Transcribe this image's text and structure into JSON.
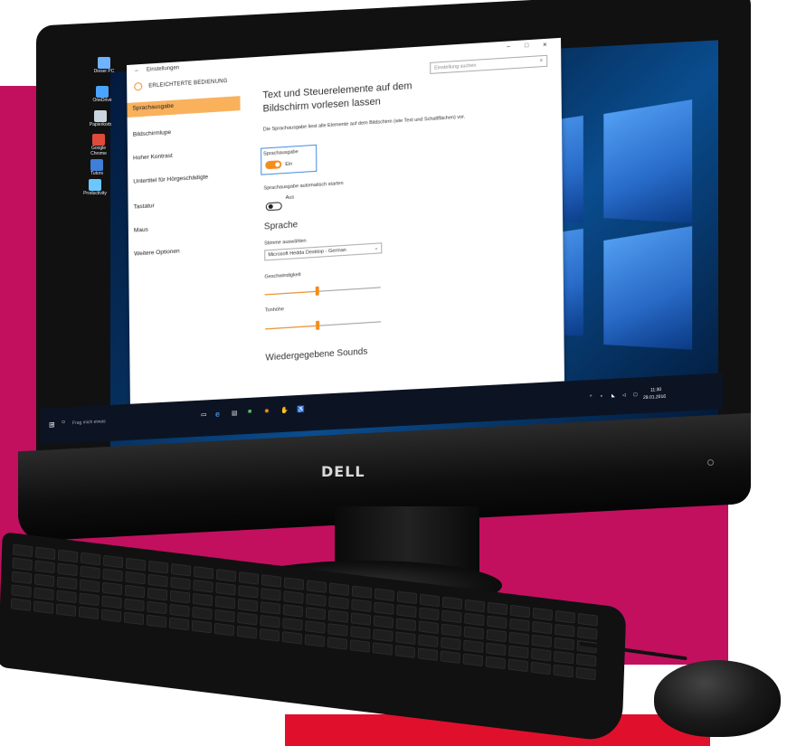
{
  "settings": {
    "back_arrow": "←",
    "title": "Einstellungen",
    "section_title": "ERLEICHTERTE BEDIENUNG",
    "search_placeholder": "Einstellung suchen",
    "window_controls": {
      "minimize": "–",
      "maximize": "□",
      "close": "×"
    },
    "nav": [
      {
        "label": "Sprachausgabe",
        "active": true
      },
      {
        "label": "Bildschirmlupe"
      },
      {
        "label": "Hoher Kontrast"
      },
      {
        "label": "Untertitel für Hörgeschädigte"
      },
      {
        "label": "Tastatur"
      },
      {
        "label": "Maus"
      },
      {
        "label": "Weitere Optionen"
      }
    ],
    "content": {
      "heading_line1": "Text und Steuerelemente auf dem",
      "heading_line2": "Bildschirm vorlesen lassen",
      "description": "Die Sprachausgabe liest alle Elemente auf dem Bildschirm (wie Text und Schaltflächen) vor.",
      "narrator_label": "Sprachausgabe",
      "narrator_state": "Ein",
      "autostart_label": "Sprachausgabe automatisch starten",
      "autostart_state": "Aus",
      "language_heading": "Sprache",
      "voice_label": "Stimme auswählen",
      "voice_value": "Microsoft Hedda Desktop - German",
      "speed_label": "Geschwindigkeit",
      "speed_value": 0.45,
      "pitch_label": "Tonhöhe",
      "pitch_value": 0.45,
      "sounds_heading": "Wiedergegebene Sounds"
    }
  },
  "desktop_icons": [
    {
      "label": "Dieser PC",
      "icon": "computer-icon",
      "color": "#6fb3ff"
    },
    {
      "label": "OneDrive",
      "icon": "cloud-icon",
      "color": "#4aa3ff"
    },
    {
      "label": "Papierkorb",
      "icon": "recycle-bin-icon",
      "color": "#c9d4e0"
    },
    {
      "label": "Google Chrome",
      "icon": "chrome-icon",
      "color": "#e04a3c"
    },
    {
      "label": "Tutors",
      "icon": "tutors-icon",
      "color": "#3f7fd9"
    },
    {
      "label": "Productivity",
      "icon": "productivity-icon",
      "color": "#6cc6ff"
    }
  ],
  "taskbar": {
    "search_placeholder": "Frag mich etwas",
    "clock_time": "11:30",
    "clock_date": "29.01.2016"
  },
  "brand": "DELL",
  "colors": {
    "accent": "#f58c1b",
    "highlight": "#3f8bdf",
    "backdrop": "#c2105f",
    "backdrop_bottom": "#e0102c"
  }
}
